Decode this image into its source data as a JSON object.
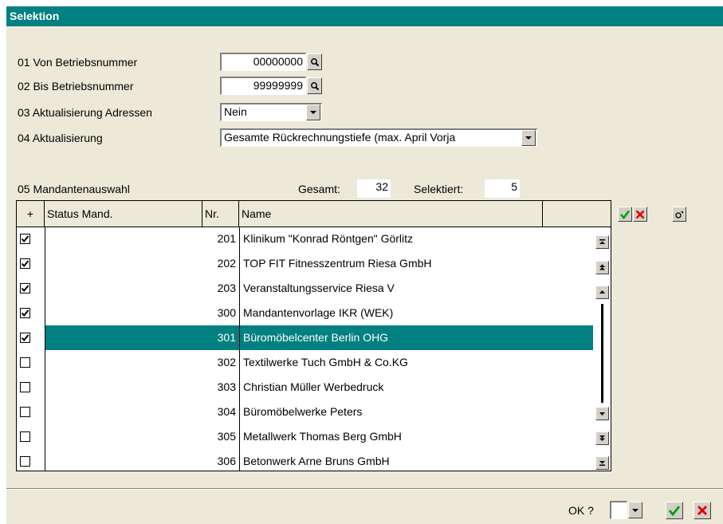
{
  "window": {
    "title": "Selektion"
  },
  "form": {
    "fields": [
      {
        "label": "01 Von Betriebsnummer",
        "value": "00000000"
      },
      {
        "label": "02 Bis Betriebsnummer",
        "value": "99999999"
      },
      {
        "label": "03 Aktualisierung Adressen",
        "value": "Nein"
      },
      {
        "label": "04 Aktualisierung",
        "value": "Gesamte Rückrechnungstiefe (max. April Vorja"
      }
    ]
  },
  "mandanten": {
    "label": "05 Mandantenauswahl",
    "gesamt_label": "Gesamt:",
    "gesamt_value": "32",
    "selektiert_label": "Selektiert:",
    "selektiert_value": "5",
    "columns": [
      "+",
      "Status Mand.",
      "Nr.",
      "Name"
    ],
    "rows": [
      {
        "checked": true,
        "status": "",
        "nr": "201",
        "name": "Klinikum \"Konrad Röntgen\" Görlitz"
      },
      {
        "checked": true,
        "status": "",
        "nr": "202",
        "name": "TOP FIT Fitnesszentrum Riesa GmbH"
      },
      {
        "checked": true,
        "status": "",
        "nr": "203",
        "name": "Veranstaltungsservice Riesa V"
      },
      {
        "checked": true,
        "status": "",
        "nr": "300",
        "name": "Mandantenvorlage IKR (WEK)"
      },
      {
        "checked": true,
        "status": "",
        "nr": "301",
        "name": "Büromöbelcenter Berlin OHG",
        "selected": true
      },
      {
        "checked": false,
        "status": "",
        "nr": "302",
        "name": "Textilwerke Tuch GmbH & Co.KG"
      },
      {
        "checked": false,
        "status": "",
        "nr": "303",
        "name": "Christian Müller Werbedruck"
      },
      {
        "checked": false,
        "status": "",
        "nr": "304",
        "name": "Büromöbelwerke Peters"
      },
      {
        "checked": false,
        "status": "",
        "nr": "305",
        "name": "Metallwerk Thomas Berg GmbH"
      },
      {
        "checked": false,
        "status": "",
        "nr": "306",
        "name": "Betonwerk Arne Bruns GmbH"
      }
    ]
  },
  "footer": {
    "ok_label": "OK ?",
    "ok_value": ""
  },
  "colors": {
    "accent": "#008080",
    "confirm": "#00a000",
    "cancel": "#e00000",
    "panel": "#ece9d8"
  },
  "icons": [
    "search-icon",
    "chevron-down-icon",
    "check-icon",
    "close-icon",
    "scroll-top-icon",
    "page-up-icon",
    "scroll-up-icon",
    "scroll-down-icon",
    "page-down-icon",
    "scroll-bottom-icon",
    "options-icon"
  ]
}
